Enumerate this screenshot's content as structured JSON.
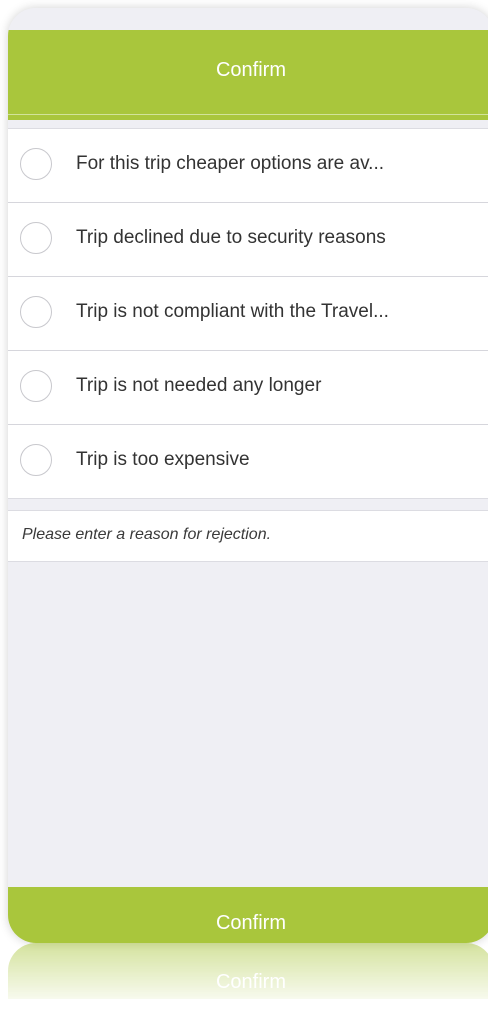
{
  "header": {
    "title": "Confirm"
  },
  "options": [
    {
      "label": "For this trip cheaper options are av..."
    },
    {
      "label": "Trip declined due to security reasons"
    },
    {
      "label": "Trip is not compliant with the Travel..."
    },
    {
      "label": "Trip is not needed any longer"
    },
    {
      "label": "Trip is too expensive"
    }
  ],
  "reason": {
    "placeholder": "Please enter a reason for rejection."
  },
  "footer": {
    "confirm_label": "Confirm"
  },
  "colors": {
    "accent": "#a9c63c",
    "background": "#efeff4"
  }
}
